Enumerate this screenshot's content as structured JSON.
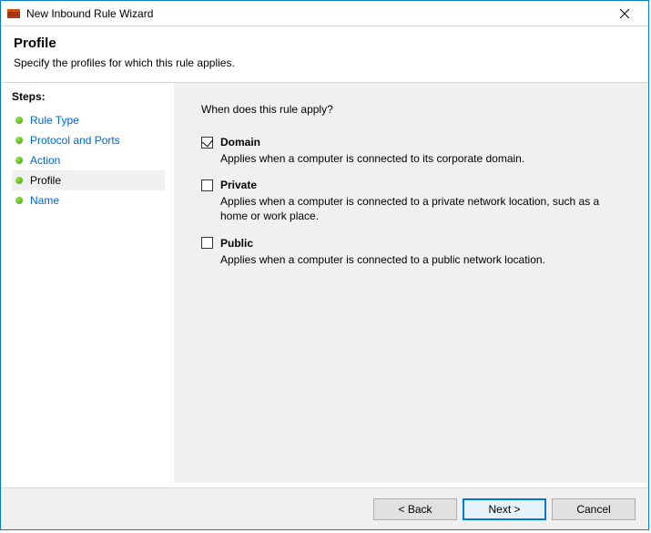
{
  "title": "New Inbound Rule Wizard",
  "header": {
    "title": "Profile",
    "subtitle": "Specify the profiles for which this rule applies."
  },
  "sidebar": {
    "heading": "Steps:",
    "items": [
      {
        "label": "Rule Type",
        "current": false
      },
      {
        "label": "Protocol and Ports",
        "current": false
      },
      {
        "label": "Action",
        "current": false
      },
      {
        "label": "Profile",
        "current": true
      },
      {
        "label": "Name",
        "current": false
      }
    ]
  },
  "main": {
    "prompt": "When does this rule apply?",
    "options": [
      {
        "name": "Domain",
        "checked": true,
        "desc": "Applies when a computer is connected to its corporate domain."
      },
      {
        "name": "Private",
        "checked": false,
        "desc": "Applies when a computer is connected to a private network location, such as a home or work place."
      },
      {
        "name": "Public",
        "checked": false,
        "desc": "Applies when a computer is connected to a public network location."
      }
    ]
  },
  "buttons": {
    "back": "< Back",
    "next": "Next >",
    "cancel": "Cancel"
  }
}
